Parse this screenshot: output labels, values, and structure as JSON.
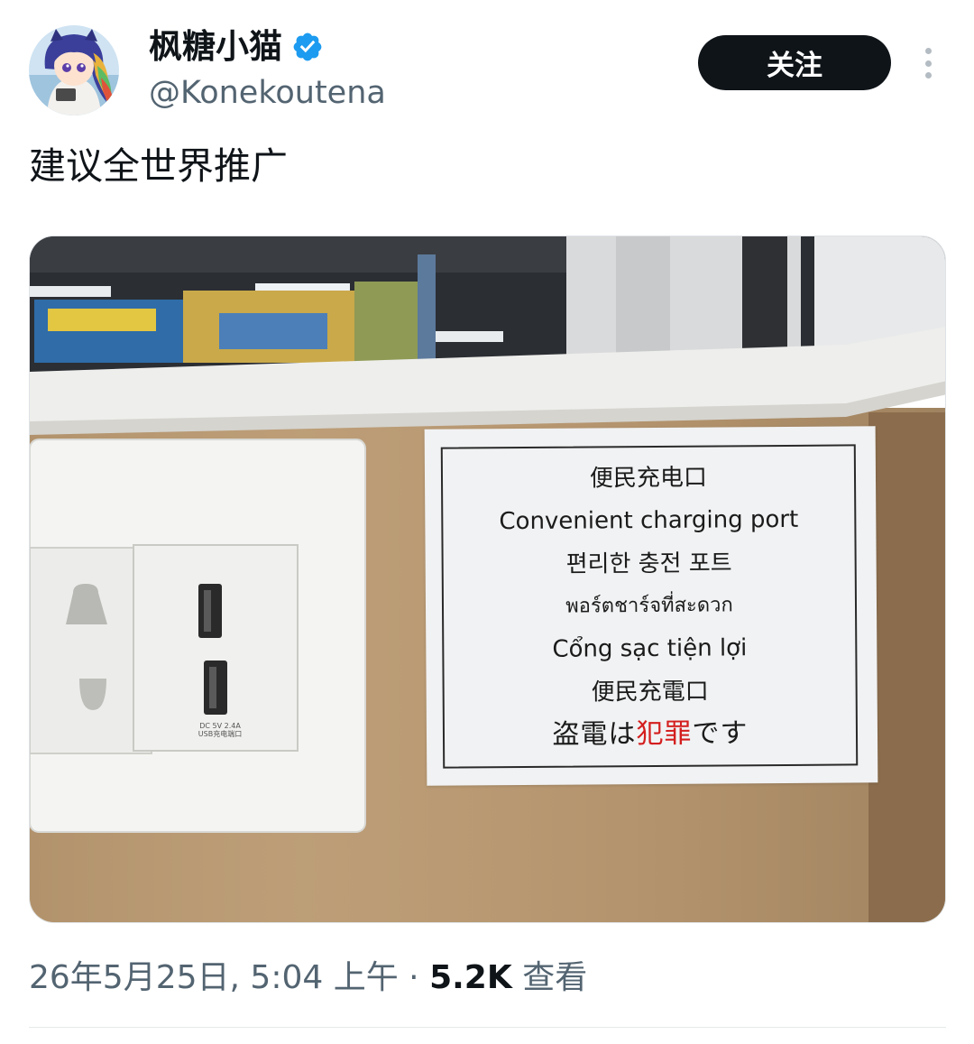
{
  "author": {
    "display_name": "枫糖小猫",
    "handle": "@Konekoutena",
    "verified": true,
    "avatar_icon": "anime-avatar-icon"
  },
  "actions": {
    "follow_label": "关注",
    "more_icon": "more-vertical-icon"
  },
  "tweet": {
    "text": "建议全世界推广"
  },
  "media": {
    "sign_lines": [
      "便民充电口",
      "Convenient charging port",
      "편리한 충전 포트",
      "พอร์ตชาร์จที่สะดวก",
      "Cổng sạc tiện lợi",
      "便民充電口"
    ],
    "sign_last_line": {
      "prefix": "盗電は",
      "highlight": "犯罪",
      "suffix": "です",
      "highlight_color": "#d41e1e"
    },
    "usb_label_1": "DC 5V  2.4A",
    "usb_label_2": "USB充电端口"
  },
  "meta": {
    "timestamp": "26年5月25日, 5:04 上午",
    "separator": "·",
    "views_count": "5.2K",
    "views_label": "查看"
  },
  "colors": {
    "brand_verified": "#1d9bf0",
    "follow_bg": "#0f1419",
    "secondary_text": "#536471"
  }
}
